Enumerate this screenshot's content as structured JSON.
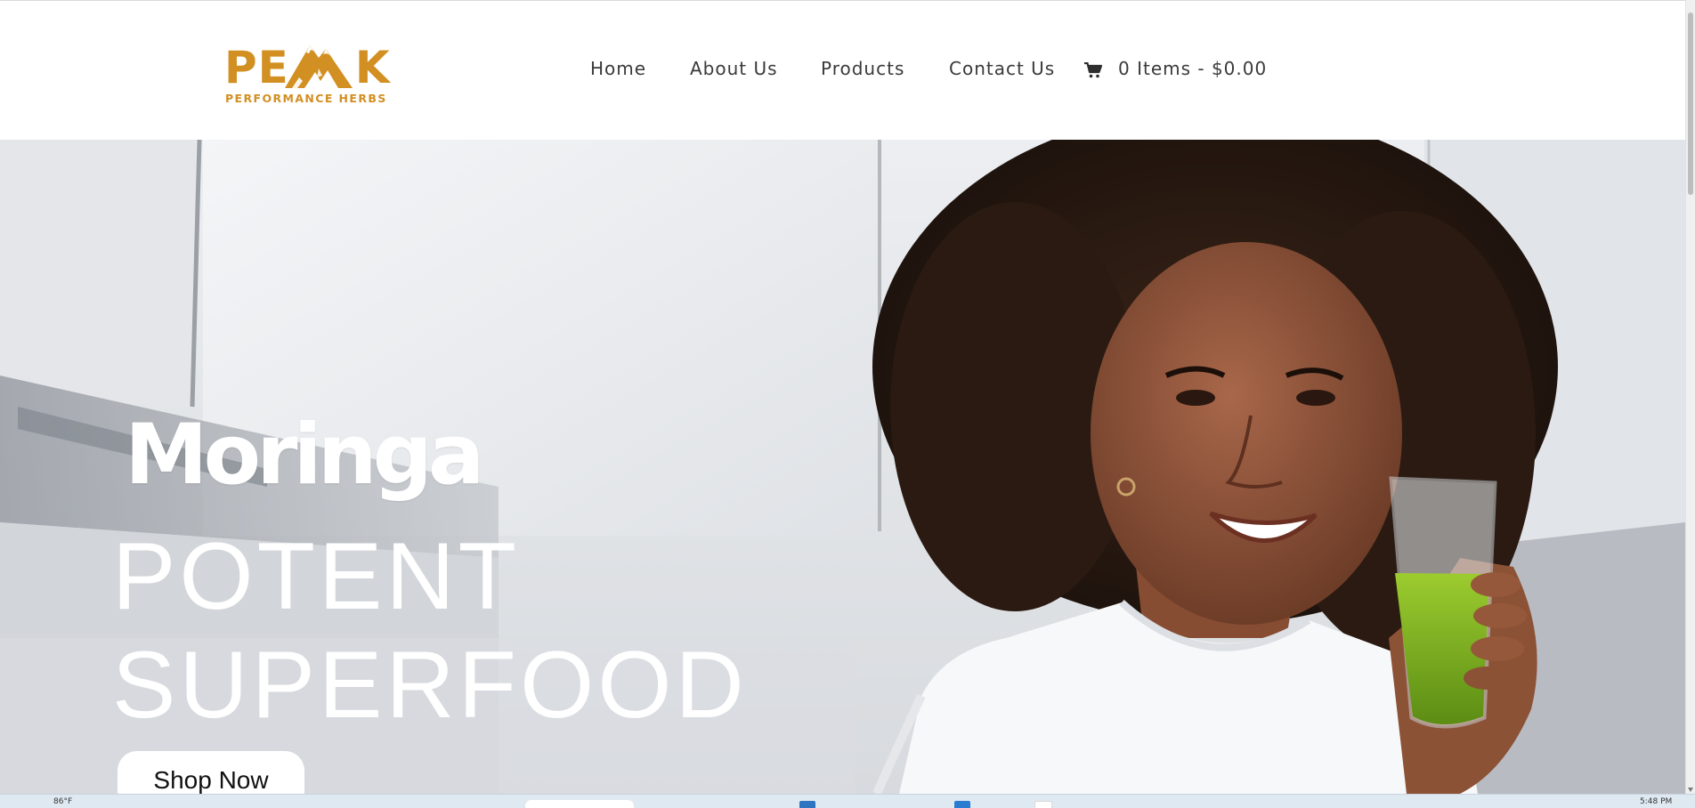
{
  "header": {
    "logo": {
      "word": "PEAK",
      "subtitle": "PERFORMANCE HERBS",
      "color": "#d28f22"
    },
    "nav": [
      {
        "label": "Home"
      },
      {
        "label": "About Us"
      },
      {
        "label": "Products"
      },
      {
        "label": "Contact Us"
      }
    ],
    "cart": {
      "icon": "cart-icon",
      "label": "0 Items - $0.00"
    }
  },
  "hero": {
    "title": "Moringa",
    "line1": "POTENT",
    "line2": "SUPERFOOD",
    "button_label": "Shop Now"
  },
  "taskbar": {
    "weather_text": "86°F",
    "clock_text": "5:48 PM"
  }
}
